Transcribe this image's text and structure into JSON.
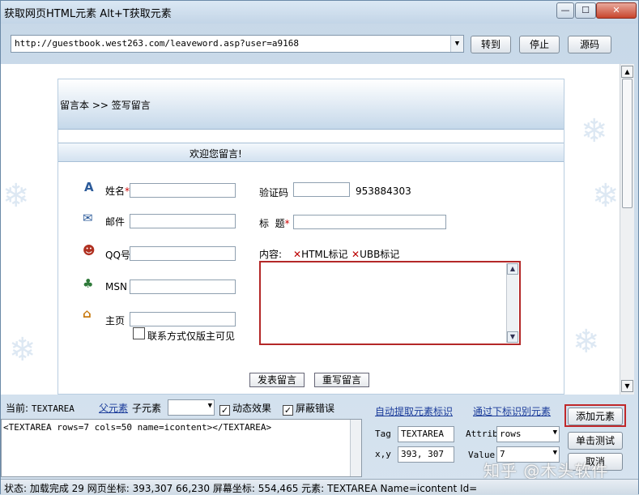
{
  "window": {
    "title": "获取网页HTML元素  Alt+T获取元素",
    "min": "—",
    "max": "☐",
    "close": "✕"
  },
  "toolbar": {
    "url": "http://guestbook.west263.com/leaveword.asp?user=a9168",
    "go": "转到",
    "stop": "停止",
    "source": "源码"
  },
  "page": {
    "breadcrumb": "留言本 >> 签写留言",
    "welcome": "欢迎您留言!",
    "name_label": "姓名",
    "email_label": "邮件",
    "qq_label": "QQ号",
    "msn_label": "MSN",
    "home_label": "主页",
    "private_label": "联系方式仅版主可见",
    "captcha_label": "验证码",
    "captcha_value": "953884303",
    "subject_label": "标  题",
    "content_label": "内容:",
    "html_tag": "HTML标记",
    "ubb_tag": "UBB标记",
    "submit": "发表留言",
    "reset": "重写留言",
    "required_mark": "*",
    "disabled_x": "✕"
  },
  "inspector": {
    "current_label": "当前:",
    "current_value": "TEXTAREA",
    "parent_link": "父元素",
    "child_label": "子元素",
    "dynamic_label": "动态效果",
    "block_errors_label": "屏蔽错误",
    "auto_extract": "自动提取元素标识",
    "by_tag": "通过下标识别元素",
    "add_element": "添加元素",
    "click_test": "单击测试",
    "cancel": "取消",
    "source_text": "<TEXTAREA rows=7 cols=50 name=icontent></TEXTAREA>",
    "tag_label": "Tag",
    "tag_value": "TEXTAREA",
    "attrib_label": "Attrib",
    "attrib_value": "rows",
    "xy_label": "x,y",
    "xy_value": "393, 307",
    "value_label": "Value",
    "value_value": "7"
  },
  "status": {
    "text": "状态: 加载完成  29  网页坐标: 393,307  66,230  屏幕坐标: 554,465  元素: TEXTAREA Name=icontent Id="
  },
  "watermark": "知乎 @木头软件",
  "icons": {
    "name": "A",
    "email": "✉",
    "qq": "☻",
    "msn": "♣",
    "home": "⌂"
  }
}
